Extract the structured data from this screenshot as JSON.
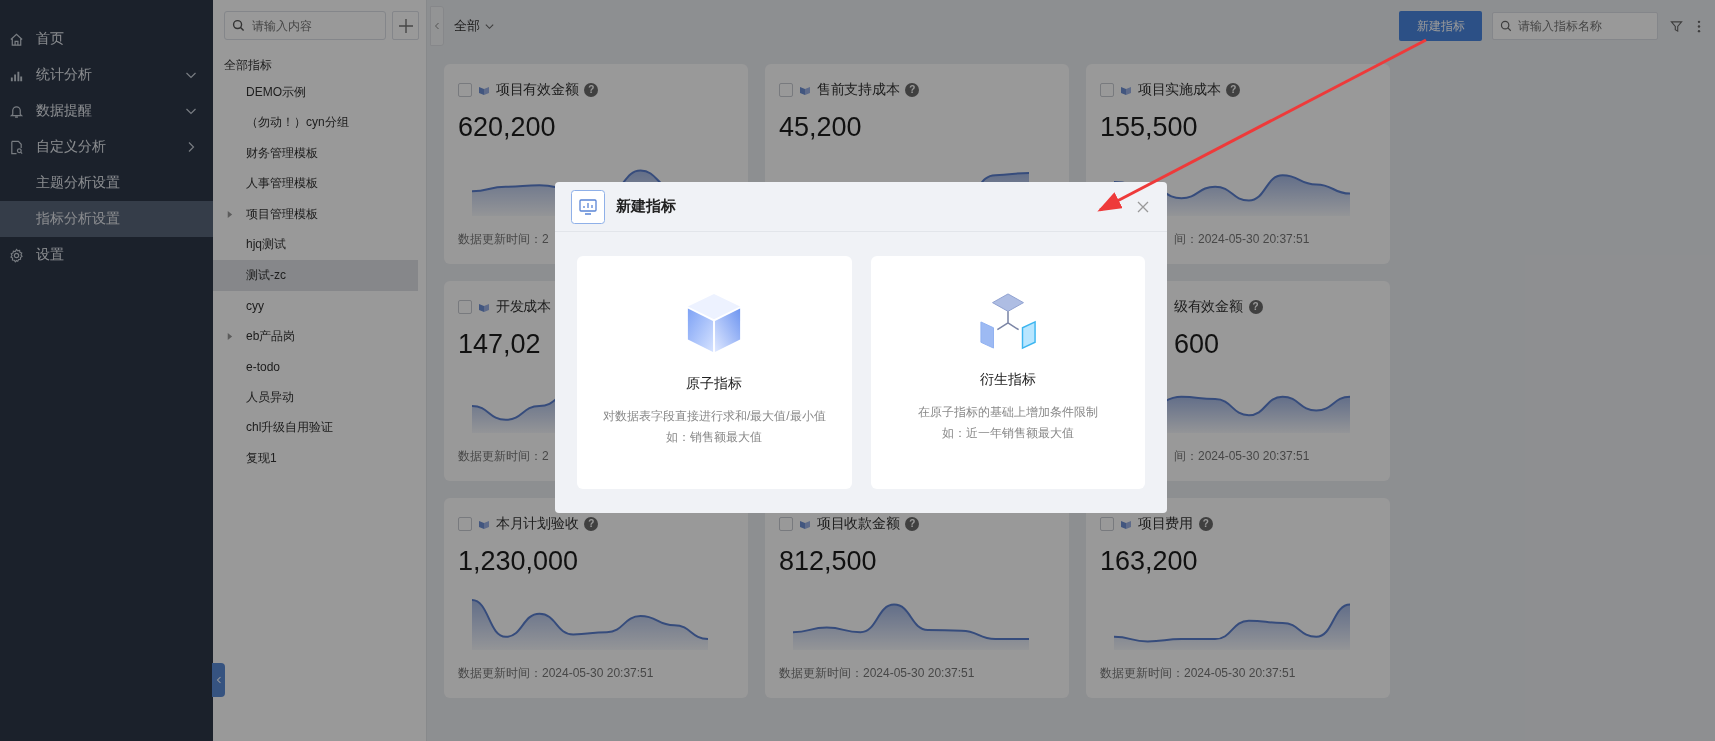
{
  "sidebar": {
    "items": [
      {
        "label": "首页",
        "kind": "link",
        "selected": false
      },
      {
        "label": "统计分析",
        "kind": "submenu",
        "selected": false
      },
      {
        "label": "数据提醒",
        "kind": "submenu",
        "selected": false
      },
      {
        "label": "自定义分析",
        "kind": "popup",
        "selected": false
      },
      {
        "label": "主题分析设置",
        "kind": "link",
        "selected": false
      },
      {
        "label": "指标分析设置",
        "kind": "link",
        "selected": true
      },
      {
        "label": "设置",
        "kind": "link",
        "selected": false
      }
    ]
  },
  "tree": {
    "search": {
      "placeholder": "请输入内容"
    },
    "root": {
      "label": "全部指标",
      "children": [
        {
          "label": "DEMO示例",
          "selected": false
        },
        {
          "label": "（勿动！）cyn分组",
          "selected": false
        },
        {
          "label": "财务管理模板",
          "selected": false
        },
        {
          "label": "人事管理模板",
          "selected": false
        },
        {
          "label": "项目管理模板",
          "selected": false,
          "expanded": false
        },
        {
          "label": "hjq测试",
          "selected": false
        },
        {
          "label": "测试-zc",
          "selected": true
        },
        {
          "label": "cyy",
          "selected": false
        },
        {
          "label": "eb产品岗",
          "selected": false,
          "expanded": false
        },
        {
          "label": "e-todo",
          "selected": false
        },
        {
          "label": "人员异动",
          "selected": false
        },
        {
          "label": "chl升级自用验证",
          "selected": false
        },
        {
          "label": "复现1",
          "selected": false
        }
      ]
    }
  },
  "toolbar": {
    "scope": "全部",
    "new_button": "新建指标",
    "search": {
      "placeholder": "请输入指标名称"
    }
  },
  "cards": [
    {
      "title": "项目有效金额",
      "checked": false,
      "hint": "?",
      "value": "620,200",
      "updated": "数据更新时间：2"
    },
    {
      "title": "售前支持成本",
      "checked": false,
      "hint": "?",
      "value": "45,200"
    },
    {
      "title": "项目实施成本",
      "checked": false,
      "hint": "?",
      "value": "155,500",
      "updated": "间：2024-05-30 20:37:51"
    },
    {
      "title": "开发成本",
      "checked": false,
      "value": "147,02",
      "updated": "数据更新时间：2"
    },
    {
      "title": "级有效金额",
      "hint": "?",
      "value": "600",
      "updated": "间：2024-05-30 20:37:51"
    },
    {
      "title": "本月计划验收",
      "checked": false,
      "hint": "?",
      "value": "1,230,000",
      "updated": "数据更新时间：2024-05-30 20:37:51"
    },
    {
      "title": "项目收款金额",
      "checked": false,
      "hint": "?",
      "value": "812,500",
      "updated": "数据更新时间：2024-05-30 20:37:51"
    },
    {
      "title": "项目费用",
      "checked": false,
      "hint": "?",
      "value": "163,200",
      "updated": "数据更新时间：2024-05-30 20:37:51"
    }
  ],
  "dialog": {
    "title": "新建指标",
    "options": [
      {
        "kind": "atomic",
        "title": "原子指标",
        "lines": [
          "对数据表字段直接进行求和/最大值/最小值",
          "如：销售额最大值"
        ]
      },
      {
        "kind": "derived",
        "title": "衍生指标",
        "lines": [
          "在原子指标的基础上增加条件限制",
          "如：近一年销售额最大值"
        ]
      }
    ]
  }
}
